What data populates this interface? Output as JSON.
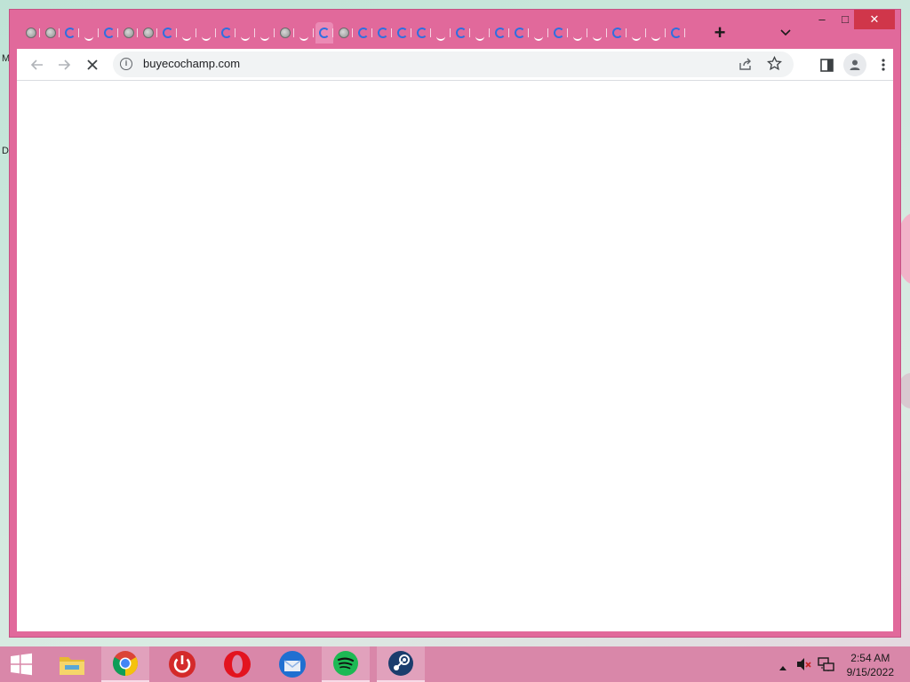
{
  "browser": {
    "tab_count_visible": 34,
    "new_tab_label": "+",
    "address": "buyecochamp.com",
    "window_controls": {
      "minimize": "–",
      "maximize": "□",
      "close": "✕"
    }
  },
  "desktop": {
    "edge_letters": [
      "M",
      "D"
    ]
  },
  "taskbar": {
    "apps": [
      {
        "name": "start",
        "icon": "windows-logo-icon"
      },
      {
        "name": "file-explorer",
        "icon": "folder-icon"
      },
      {
        "name": "chrome",
        "icon": "chrome-icon",
        "running": true
      },
      {
        "name": "power",
        "icon": "power-icon"
      },
      {
        "name": "opera",
        "icon": "opera-icon"
      },
      {
        "name": "thunderbird",
        "icon": "thunderbird-icon"
      },
      {
        "name": "spotify",
        "icon": "spotify-icon",
        "running": true
      },
      {
        "name": "steam",
        "icon": "steam-icon",
        "running": true
      }
    ],
    "time": "2:54 AM",
    "date": "9/15/2022"
  },
  "colors": {
    "window_frame": "#e1699b",
    "taskbar": "#d987a9",
    "close_button": "#d0364a"
  }
}
